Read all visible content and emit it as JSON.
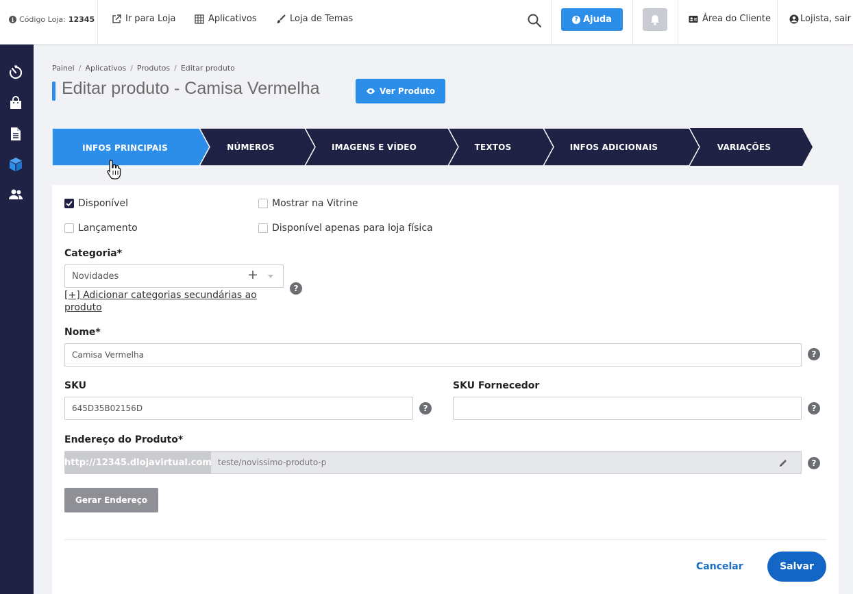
{
  "topbar": {
    "store_code_label": "Código Loja:",
    "store_code": "12345",
    "links": [
      {
        "label": "Ir para Loja",
        "icon": "external-link-icon"
      },
      {
        "label": "Aplicativos",
        "icon": "grid-icon"
      },
      {
        "label": "Loja de Temas",
        "icon": "brush-icon"
      }
    ],
    "help_label": "Ajuda",
    "client_area_label": "Área do Cliente",
    "user_label": "Lojista, sair"
  },
  "sidebar": {
    "items": [
      "dashboard-icon",
      "bag-icon",
      "document-icon",
      "box-icon",
      "users-icon"
    ]
  },
  "breadcrumb": [
    "Painel",
    "Aplicativos",
    "Produtos",
    "Editar produto"
  ],
  "page": {
    "title": "Editar produto - Camisa Vermelha",
    "view_button": "Ver Produto"
  },
  "steps": [
    {
      "label": "INFOS PRINCIPAIS",
      "active": true
    },
    {
      "label": "NÚMEROS",
      "active": false
    },
    {
      "label": "IMAGENS E VÍDEO",
      "active": false
    },
    {
      "label": "TEXTOS",
      "active": false
    },
    {
      "label": "INFOS ADICIONAIS",
      "active": false
    },
    {
      "label": "VARIAÇÕES",
      "active": false
    }
  ],
  "form": {
    "checkboxes": {
      "disponivel": {
        "label": "Disponível",
        "checked": true
      },
      "vitrine": {
        "label": "Mostrar na Vitrine",
        "checked": false
      },
      "lancamento": {
        "label": "Lançamento",
        "checked": false
      },
      "loja_fisica": {
        "label": "Disponível apenas para loja física",
        "checked": false
      }
    },
    "category_label": "Categoria*",
    "category_value": "Novidades",
    "add_categories_link": "[+] Adicionar categorias secundárias ao produto",
    "name_label": "Nome*",
    "name_value": "Camisa Vermelha",
    "sku_label": "SKU",
    "sku_value": "645D35B02156D",
    "sku_supplier_label": "SKU Fornecedor",
    "sku_supplier_value": "",
    "address_label": "Endereço do Produto*",
    "address_prefix": "http://12345.dlojavirtual.com",
    "address_path": "teste/novissimo-produto-p",
    "generate_button": "Gerar Endereço",
    "cancel_label": "Cancelar",
    "save_label": "Salvar"
  },
  "colors": {
    "primary": "#2c8ee8",
    "sidebar": "#1f2145",
    "step_inactive": "#1f2145",
    "save": "#1466c6"
  }
}
